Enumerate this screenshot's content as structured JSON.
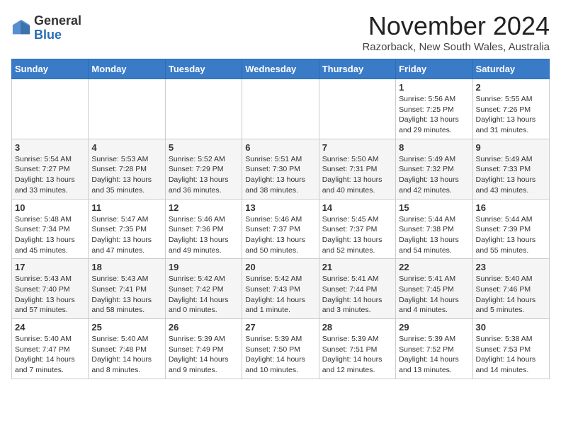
{
  "header": {
    "logo_line1": "General",
    "logo_line2": "Blue",
    "month": "November 2024",
    "subtitle": "Razorback, New South Wales, Australia"
  },
  "days_of_week": [
    "Sunday",
    "Monday",
    "Tuesday",
    "Wednesday",
    "Thursday",
    "Friday",
    "Saturday"
  ],
  "weeks": [
    [
      {
        "day": "",
        "info": ""
      },
      {
        "day": "",
        "info": ""
      },
      {
        "day": "",
        "info": ""
      },
      {
        "day": "",
        "info": ""
      },
      {
        "day": "",
        "info": ""
      },
      {
        "day": "1",
        "info": "Sunrise: 5:56 AM\nSunset: 7:25 PM\nDaylight: 13 hours and 29 minutes."
      },
      {
        "day": "2",
        "info": "Sunrise: 5:55 AM\nSunset: 7:26 PM\nDaylight: 13 hours and 31 minutes."
      }
    ],
    [
      {
        "day": "3",
        "info": "Sunrise: 5:54 AM\nSunset: 7:27 PM\nDaylight: 13 hours and 33 minutes."
      },
      {
        "day": "4",
        "info": "Sunrise: 5:53 AM\nSunset: 7:28 PM\nDaylight: 13 hours and 35 minutes."
      },
      {
        "day": "5",
        "info": "Sunrise: 5:52 AM\nSunset: 7:29 PM\nDaylight: 13 hours and 36 minutes."
      },
      {
        "day": "6",
        "info": "Sunrise: 5:51 AM\nSunset: 7:30 PM\nDaylight: 13 hours and 38 minutes."
      },
      {
        "day": "7",
        "info": "Sunrise: 5:50 AM\nSunset: 7:31 PM\nDaylight: 13 hours and 40 minutes."
      },
      {
        "day": "8",
        "info": "Sunrise: 5:49 AM\nSunset: 7:32 PM\nDaylight: 13 hours and 42 minutes."
      },
      {
        "day": "9",
        "info": "Sunrise: 5:49 AM\nSunset: 7:33 PM\nDaylight: 13 hours and 43 minutes."
      }
    ],
    [
      {
        "day": "10",
        "info": "Sunrise: 5:48 AM\nSunset: 7:34 PM\nDaylight: 13 hours and 45 minutes."
      },
      {
        "day": "11",
        "info": "Sunrise: 5:47 AM\nSunset: 7:35 PM\nDaylight: 13 hours and 47 minutes."
      },
      {
        "day": "12",
        "info": "Sunrise: 5:46 AM\nSunset: 7:36 PM\nDaylight: 13 hours and 49 minutes."
      },
      {
        "day": "13",
        "info": "Sunrise: 5:46 AM\nSunset: 7:37 PM\nDaylight: 13 hours and 50 minutes."
      },
      {
        "day": "14",
        "info": "Sunrise: 5:45 AM\nSunset: 7:37 PM\nDaylight: 13 hours and 52 minutes."
      },
      {
        "day": "15",
        "info": "Sunrise: 5:44 AM\nSunset: 7:38 PM\nDaylight: 13 hours and 54 minutes."
      },
      {
        "day": "16",
        "info": "Sunrise: 5:44 AM\nSunset: 7:39 PM\nDaylight: 13 hours and 55 minutes."
      }
    ],
    [
      {
        "day": "17",
        "info": "Sunrise: 5:43 AM\nSunset: 7:40 PM\nDaylight: 13 hours and 57 minutes."
      },
      {
        "day": "18",
        "info": "Sunrise: 5:43 AM\nSunset: 7:41 PM\nDaylight: 13 hours and 58 minutes."
      },
      {
        "day": "19",
        "info": "Sunrise: 5:42 AM\nSunset: 7:42 PM\nDaylight: 14 hours and 0 minutes."
      },
      {
        "day": "20",
        "info": "Sunrise: 5:42 AM\nSunset: 7:43 PM\nDaylight: 14 hours and 1 minute."
      },
      {
        "day": "21",
        "info": "Sunrise: 5:41 AM\nSunset: 7:44 PM\nDaylight: 14 hours and 3 minutes."
      },
      {
        "day": "22",
        "info": "Sunrise: 5:41 AM\nSunset: 7:45 PM\nDaylight: 14 hours and 4 minutes."
      },
      {
        "day": "23",
        "info": "Sunrise: 5:40 AM\nSunset: 7:46 PM\nDaylight: 14 hours and 5 minutes."
      }
    ],
    [
      {
        "day": "24",
        "info": "Sunrise: 5:40 AM\nSunset: 7:47 PM\nDaylight: 14 hours and 7 minutes."
      },
      {
        "day": "25",
        "info": "Sunrise: 5:40 AM\nSunset: 7:48 PM\nDaylight: 14 hours and 8 minutes."
      },
      {
        "day": "26",
        "info": "Sunrise: 5:39 AM\nSunset: 7:49 PM\nDaylight: 14 hours and 9 minutes."
      },
      {
        "day": "27",
        "info": "Sunrise: 5:39 AM\nSunset: 7:50 PM\nDaylight: 14 hours and 10 minutes."
      },
      {
        "day": "28",
        "info": "Sunrise: 5:39 AM\nSunset: 7:51 PM\nDaylight: 14 hours and 12 minutes."
      },
      {
        "day": "29",
        "info": "Sunrise: 5:39 AM\nSunset: 7:52 PM\nDaylight: 14 hours and 13 minutes."
      },
      {
        "day": "30",
        "info": "Sunrise: 5:38 AM\nSunset: 7:53 PM\nDaylight: 14 hours and 14 minutes."
      }
    ]
  ]
}
